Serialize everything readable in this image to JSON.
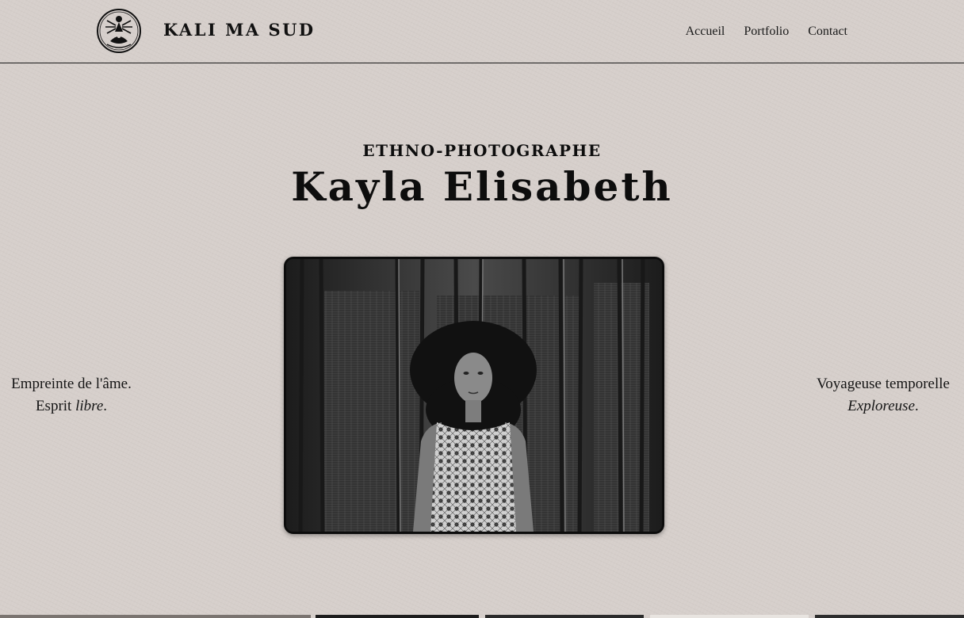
{
  "header": {
    "brand": "KALI MA SUD",
    "logo_icon": "goddess-emblem-icon",
    "nav": [
      {
        "label": "Accueil"
      },
      {
        "label": "Portfolio"
      },
      {
        "label": "Contact"
      }
    ]
  },
  "hero": {
    "subtitle": "ETHNO-PHOTOGRAPHE",
    "title": "Kayla Elisabeth"
  },
  "quotes": {
    "left": {
      "line1": "Empreinte de l'âme.",
      "line2_prefix": "Esprit ",
      "line2_em": "libre",
      "line2_suffix": "."
    },
    "right": {
      "line1": "Voyageuse temporelle",
      "line2_em": "Exploreuse",
      "line2_suffix": "."
    }
  },
  "colors": {
    "background": "#d6cfcb",
    "ink": "#111111",
    "border": "#1a1a1a"
  }
}
